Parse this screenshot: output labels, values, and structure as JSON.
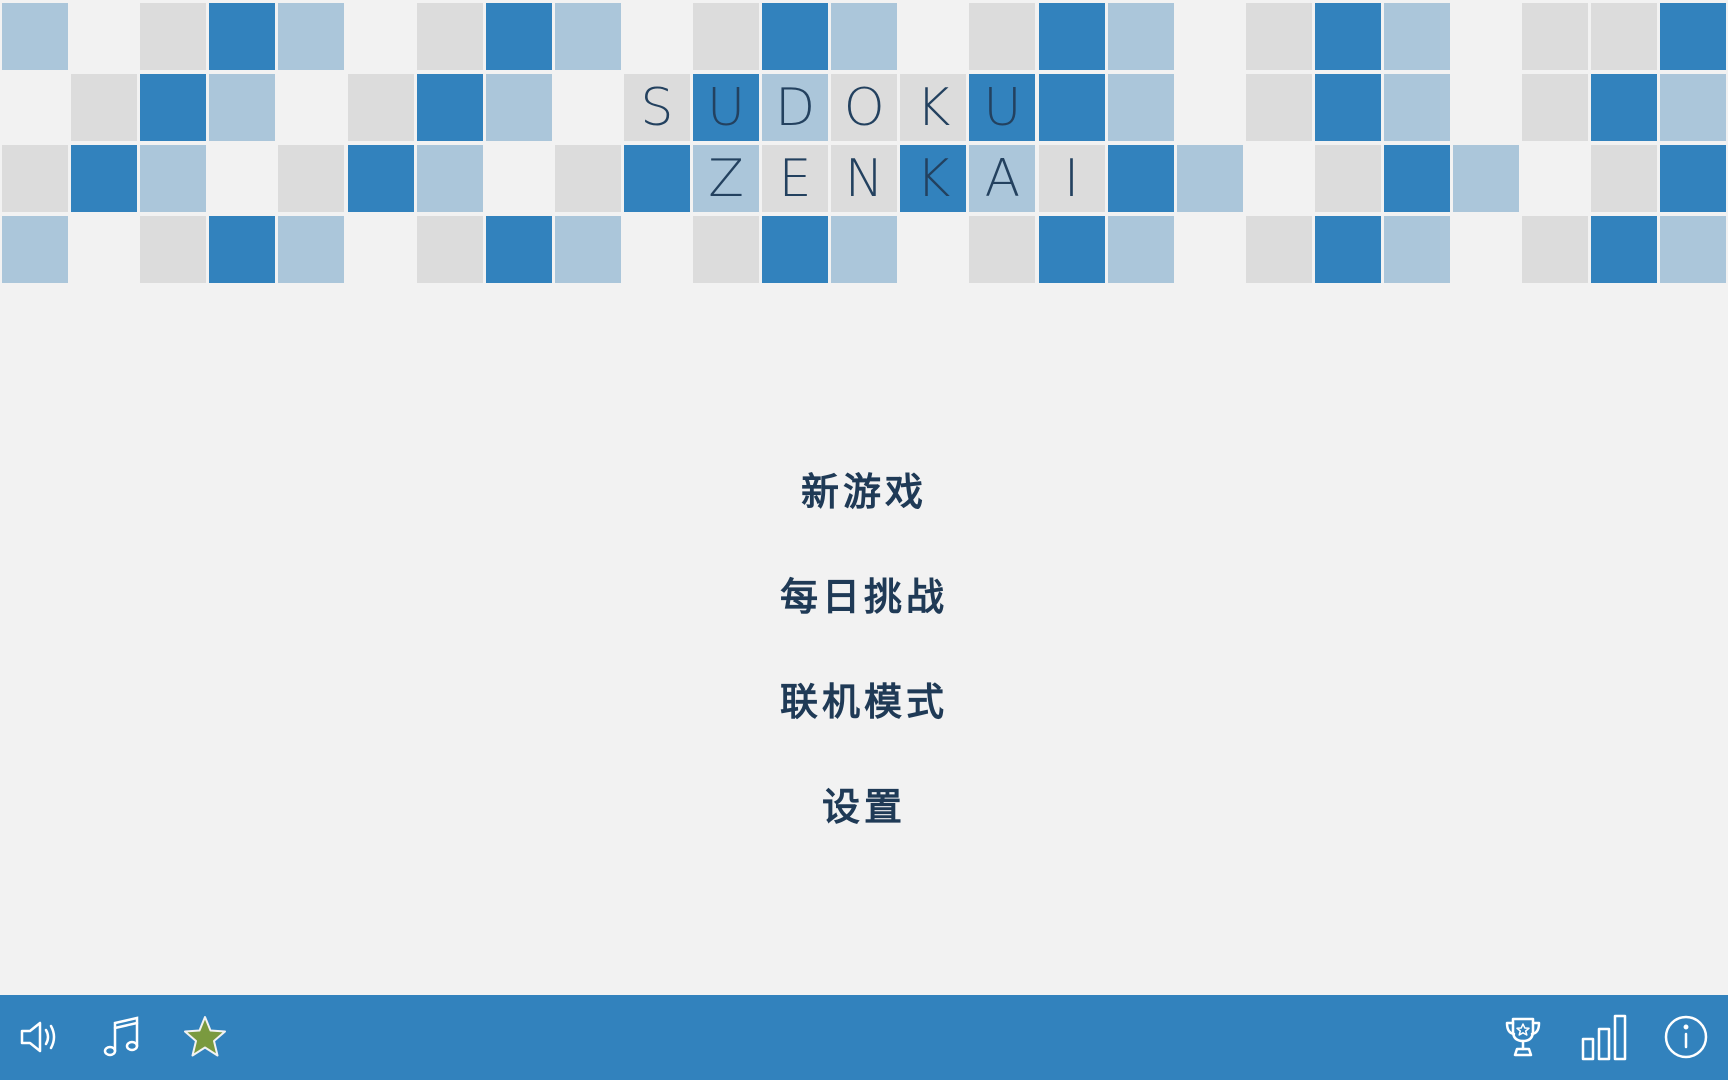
{
  "title": {
    "line1": [
      "S",
      "U",
      "D",
      "O",
      "K",
      "U"
    ],
    "line2": [
      "Z",
      "E",
      "N",
      "K",
      "A",
      "I"
    ]
  },
  "menu": {
    "new_game": "新游戏",
    "daily_challenge": "每日挑战",
    "online_mode": "联机模式",
    "settings": "设置"
  },
  "toolbar": {
    "left_icons": [
      "sound-icon",
      "music-note-icon",
      "star-icon"
    ],
    "right_icons": [
      "trophy-icon",
      "bar-chart-icon",
      "info-icon"
    ]
  },
  "colors": {
    "background": "#f2f2f2",
    "tile_dark": "#3282bd",
    "tile_light": "#abc6da",
    "tile_gray": "#dcdcdc",
    "bar": "#3282bd",
    "menu_text": "#1f3a56",
    "star": "#7a9a3f"
  }
}
